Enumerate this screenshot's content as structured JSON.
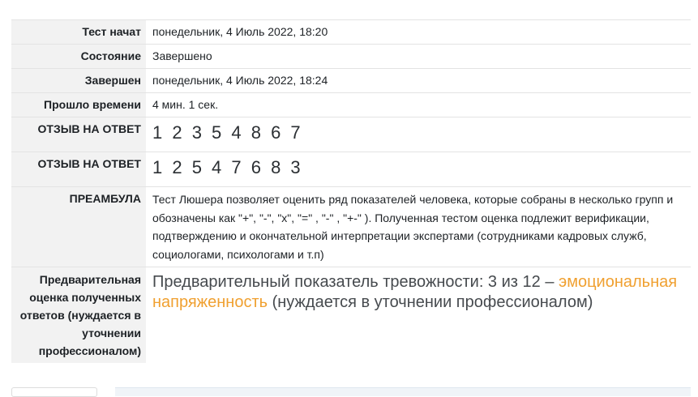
{
  "summary": {
    "started_label": "Тест начат",
    "started_value": "понедельник, 4 Июль 2022, 18:20",
    "state_label": "Состояние",
    "state_value": "Завершено",
    "completed_label": "Завершен",
    "completed_value": "понедельник, 4 Июль 2022, 18:24",
    "elapsed_label": "Прошло времени",
    "elapsed_value": "4 мин. 1 сек.",
    "feedback1_label": "ОТЗЫВ НА ОТВЕТ",
    "feedback1_value": "1 2 3 5 4 8 6 7",
    "feedback2_label": "ОТЗЫВ НА ОТВЕТ",
    "feedback2_value": "1 2 5 4 7 6 8 3",
    "preamble_label": "ПРЕАМБУЛА",
    "preamble_value": "Тест Люшера позволяет оценить ряд показателей человека, которые собраны в несколько групп и обозначены как \"+\", \"-\", \"х\", \"=\" , \"-\" , \"+-\" ). Полученная тестом оценка подлежит верификации, подтверждению и окончательной интерпретации экспертами (сотрудниками кадровых служб, социологами, психологами и т.п)",
    "estimate_label": "Предварительная оценка полученных ответов (нуждается в уточнении профессионалом)",
    "estimate_prefix": "Предварительный показатель тревожности: 3 из 12 – ",
    "estimate_highlight": "эмоциональная напряженность",
    "estimate_suffix": " (нуждается в уточнении профессионалом)"
  },
  "colors": {
    "label_bg": "#f2f2f2",
    "accent": "#f0a030",
    "text": "#1d2125"
  }
}
